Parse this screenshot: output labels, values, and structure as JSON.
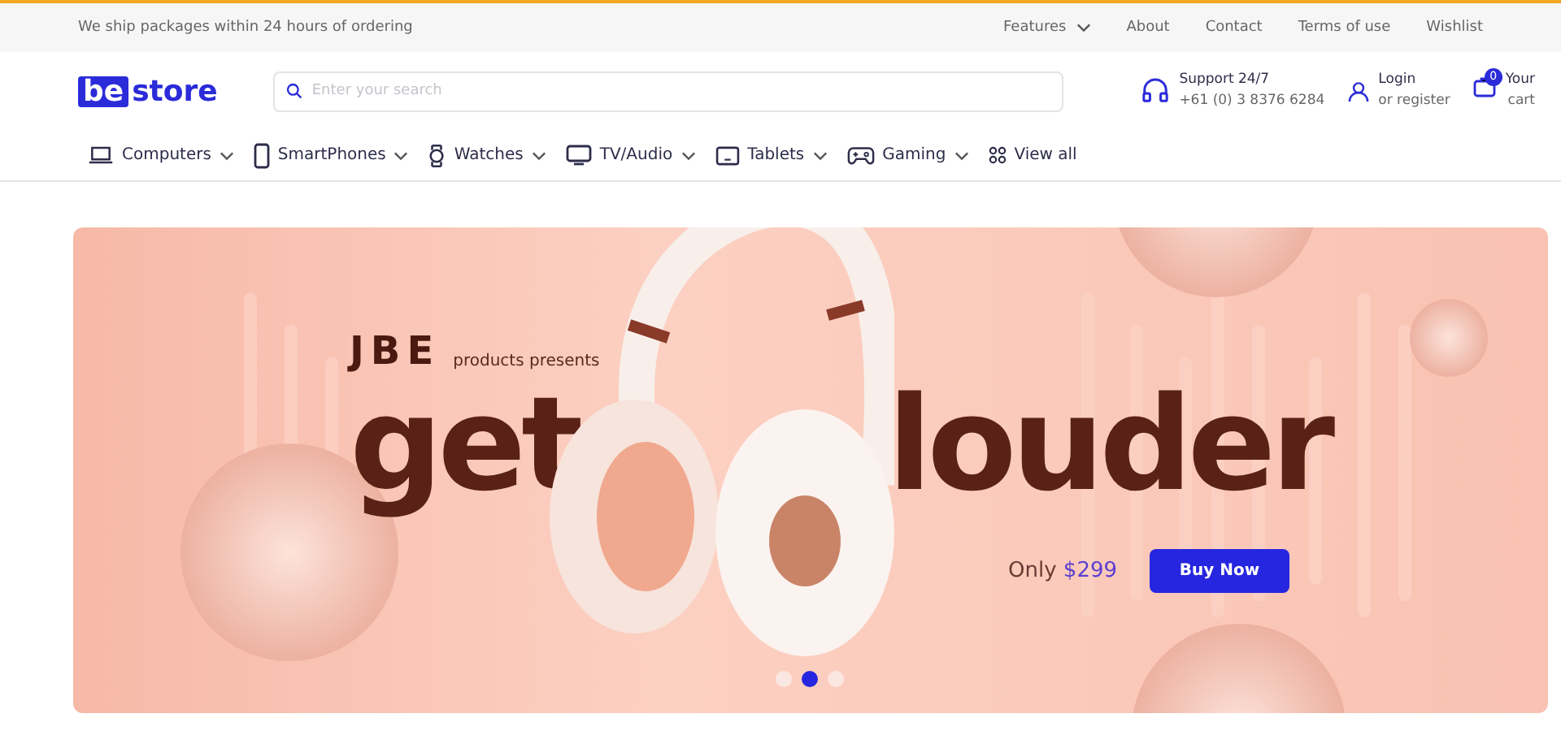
{
  "topbar": {
    "notice": "We ship packages within 24 hours of ordering",
    "links": [
      {
        "label": "Features",
        "dropdown": true
      },
      {
        "label": "About",
        "dropdown": false
      },
      {
        "label": "Contact",
        "dropdown": false
      },
      {
        "label": "Terms of use",
        "dropdown": false
      },
      {
        "label": "Wishlist",
        "dropdown": false
      }
    ]
  },
  "header": {
    "logo": {
      "mark": "be",
      "word": "store"
    },
    "search": {
      "placeholder": "Enter your search"
    },
    "support": {
      "title": "Support 24/7",
      "phone": "+61 (0) 3 8376 6284"
    },
    "account": {
      "title": "Login",
      "subtitle": "or register"
    },
    "cart": {
      "count": "0",
      "title": "Your",
      "subtitle": "cart"
    }
  },
  "categories": [
    {
      "label": "Computers",
      "kind": "laptop",
      "dropdown": true
    },
    {
      "label": "SmartPhones",
      "kind": "phone",
      "dropdown": true
    },
    {
      "label": "Watches",
      "kind": "watch",
      "dropdown": true
    },
    {
      "label": "TV/Audio",
      "kind": "tv",
      "dropdown": true
    },
    {
      "label": "Tablets",
      "kind": "tablet",
      "dropdown": true
    },
    {
      "label": "Gaming",
      "kind": "gamepad",
      "dropdown": true
    },
    {
      "label": "View all",
      "kind": "grid",
      "dropdown": false
    }
  ],
  "hero": {
    "brand": "JBE",
    "tagline": "products presents",
    "headline_left": "get",
    "headline_right": "louder",
    "price_label": "Only",
    "price": "$299",
    "button": "Buy Now",
    "slides": [
      {
        "selected": false
      },
      {
        "selected": true
      },
      {
        "selected": false
      }
    ]
  }
}
